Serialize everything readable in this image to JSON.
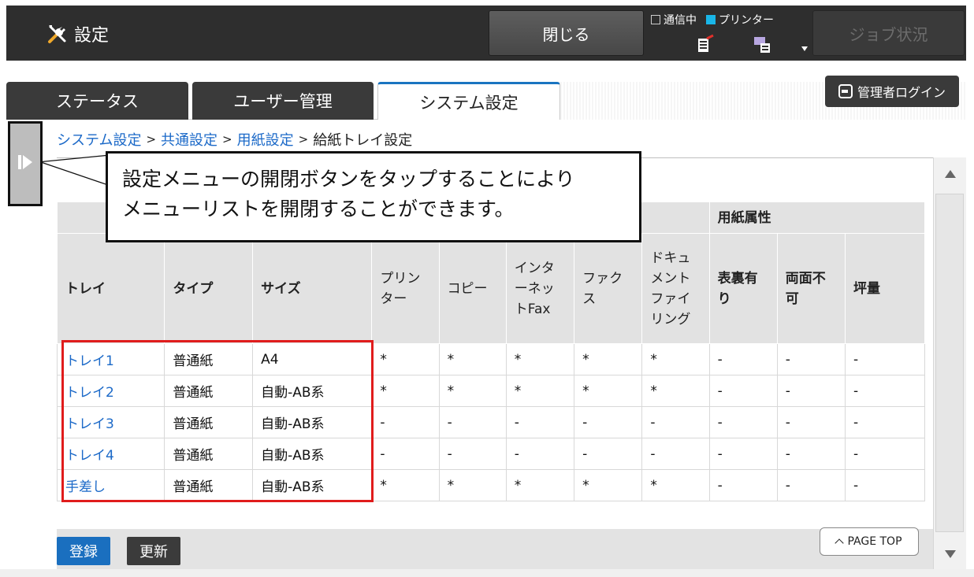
{
  "header": {
    "title": "設定",
    "close_label": "閉じる",
    "status_comm": "通信中",
    "status_printer": "プリンター",
    "job_status_label": "ジョブ状況"
  },
  "tabs": [
    {
      "label": "ステータス"
    },
    {
      "label": "ユーザー管理"
    },
    {
      "label": "システム設定"
    }
  ],
  "admin_login_label": "管理者ログイン",
  "breadcrumb": {
    "items": [
      "システム設定",
      "共通設定",
      "用紙設定",
      "給紙トレイ設定"
    ],
    "separator": ">"
  },
  "callout": {
    "line1": "設定メニューの開閉ボタンをタップすることにより",
    "line2": "メニューリストを開閉することができます。"
  },
  "table": {
    "group_header_paper_attr": "用紙属性",
    "columns": {
      "tray": "トレイ",
      "type": "タイプ",
      "size": "サイズ",
      "printer": "プリンター",
      "copy": "コピー",
      "internet_fax": "インターネットFax",
      "fax": "ファクス",
      "doc_filing": "ドキュメントファイリング",
      "duplex_ok": "表裏有り",
      "duplex_ng": "両面不可",
      "weight": "坪量"
    },
    "rows": [
      {
        "tray": "トレイ1",
        "type": "普通紙",
        "size": "A4",
        "printer": "*",
        "copy": "*",
        "ifax": "*",
        "fax": "*",
        "doc": "*",
        "dup_ok": "-",
        "dup_ng": "-",
        "weight": "-"
      },
      {
        "tray": "トレイ2",
        "type": "普通紙",
        "size": "自動-AB系",
        "printer": "*",
        "copy": "*",
        "ifax": "*",
        "fax": "*",
        "doc": "*",
        "dup_ok": "-",
        "dup_ng": "-",
        "weight": "-"
      },
      {
        "tray": "トレイ3",
        "type": "普通紙",
        "size": "自動-AB系",
        "printer": "-",
        "copy": "-",
        "ifax": "-",
        "fax": "-",
        "doc": "-",
        "dup_ok": "-",
        "dup_ng": "-",
        "weight": "-"
      },
      {
        "tray": "トレイ4",
        "type": "普通紙",
        "size": "自動-AB系",
        "printer": "-",
        "copy": "-",
        "ifax": "-",
        "fax": "-",
        "doc": "-",
        "dup_ok": "-",
        "dup_ng": "-",
        "weight": "-"
      },
      {
        "tray": "手差し",
        "type": "普通紙",
        "size": "自動-AB系",
        "printer": "*",
        "copy": "*",
        "ifax": "*",
        "fax": "*",
        "doc": "*",
        "dup_ok": "-",
        "dup_ng": "-",
        "weight": "-"
      }
    ]
  },
  "buttons": {
    "register": "登録",
    "update": "更新",
    "page_top": "PAGE TOP"
  },
  "colors": {
    "header_bg": "#2e2e2e",
    "link_blue": "#1b69c8",
    "accent_blue": "#1a6fbf",
    "highlight_red": "#e01c1c",
    "printer_cyan": "#19b6e8"
  }
}
